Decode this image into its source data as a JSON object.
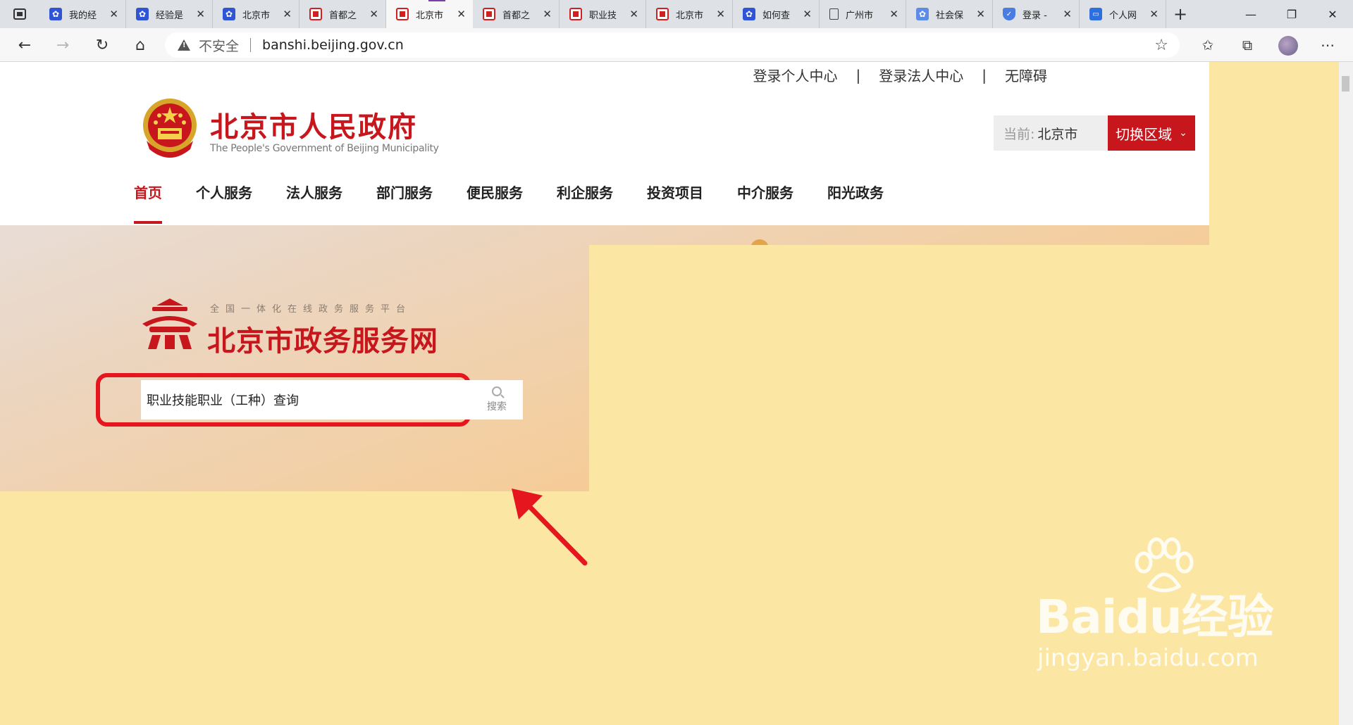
{
  "browser": {
    "tabs": [
      {
        "favicon": "paw-icon",
        "title": "我的经"
      },
      {
        "favicon": "paw-icon",
        "title": "经验是"
      },
      {
        "favicon": "paw-icon",
        "title": "北京市"
      },
      {
        "favicon": "gov-icon",
        "title": "首都之"
      },
      {
        "favicon": "gov-icon",
        "title": "北京市",
        "active": true
      },
      {
        "favicon": "gov-icon",
        "title": "首都之"
      },
      {
        "favicon": "gov-icon",
        "title": "职业技"
      },
      {
        "favicon": "gov-icon",
        "title": "北京市"
      },
      {
        "favicon": "paw-icon",
        "title": "如何查"
      },
      {
        "favicon": "doc-icon",
        "title": "广州市"
      },
      {
        "favicon": "blue-icon",
        "title": "社会保"
      },
      {
        "favicon": "shield-icon",
        "title": "登录 -"
      },
      {
        "favicon": "card-icon",
        "title": "个人网"
      }
    ],
    "security_label": "不安全",
    "url": "banshi.beijing.gov.cn"
  },
  "header": {
    "top_links": [
      "登录个人中心",
      "登录法人中心",
      "无障碍"
    ],
    "separator": "|",
    "logo_cn": "北京市人民政府",
    "logo_en": "The People's Government of Beijing Municipality",
    "region_label": "当前:",
    "region_value": "北京市",
    "switch_label": "切换区域"
  },
  "nav": {
    "items": [
      "首页",
      "个人服务",
      "法人服务",
      "部门服务",
      "便民服务",
      "利企服务",
      "投资项目",
      "中介服务",
      "阳光政务"
    ],
    "active_index": 0
  },
  "hero": {
    "tagline": "全国一体化在线政务服务平台",
    "title": "北京市政务服务网"
  },
  "search": {
    "value": "职业技能职业（工种）查询",
    "button_label": "搜索"
  },
  "watermark": {
    "main": "Baidu经验",
    "sub": "jingyan.baidu.com"
  },
  "colors": {
    "brand_red": "#c8161d",
    "highlight_red": "#e6161f",
    "overlay_yellow": "#fbe7a3"
  }
}
